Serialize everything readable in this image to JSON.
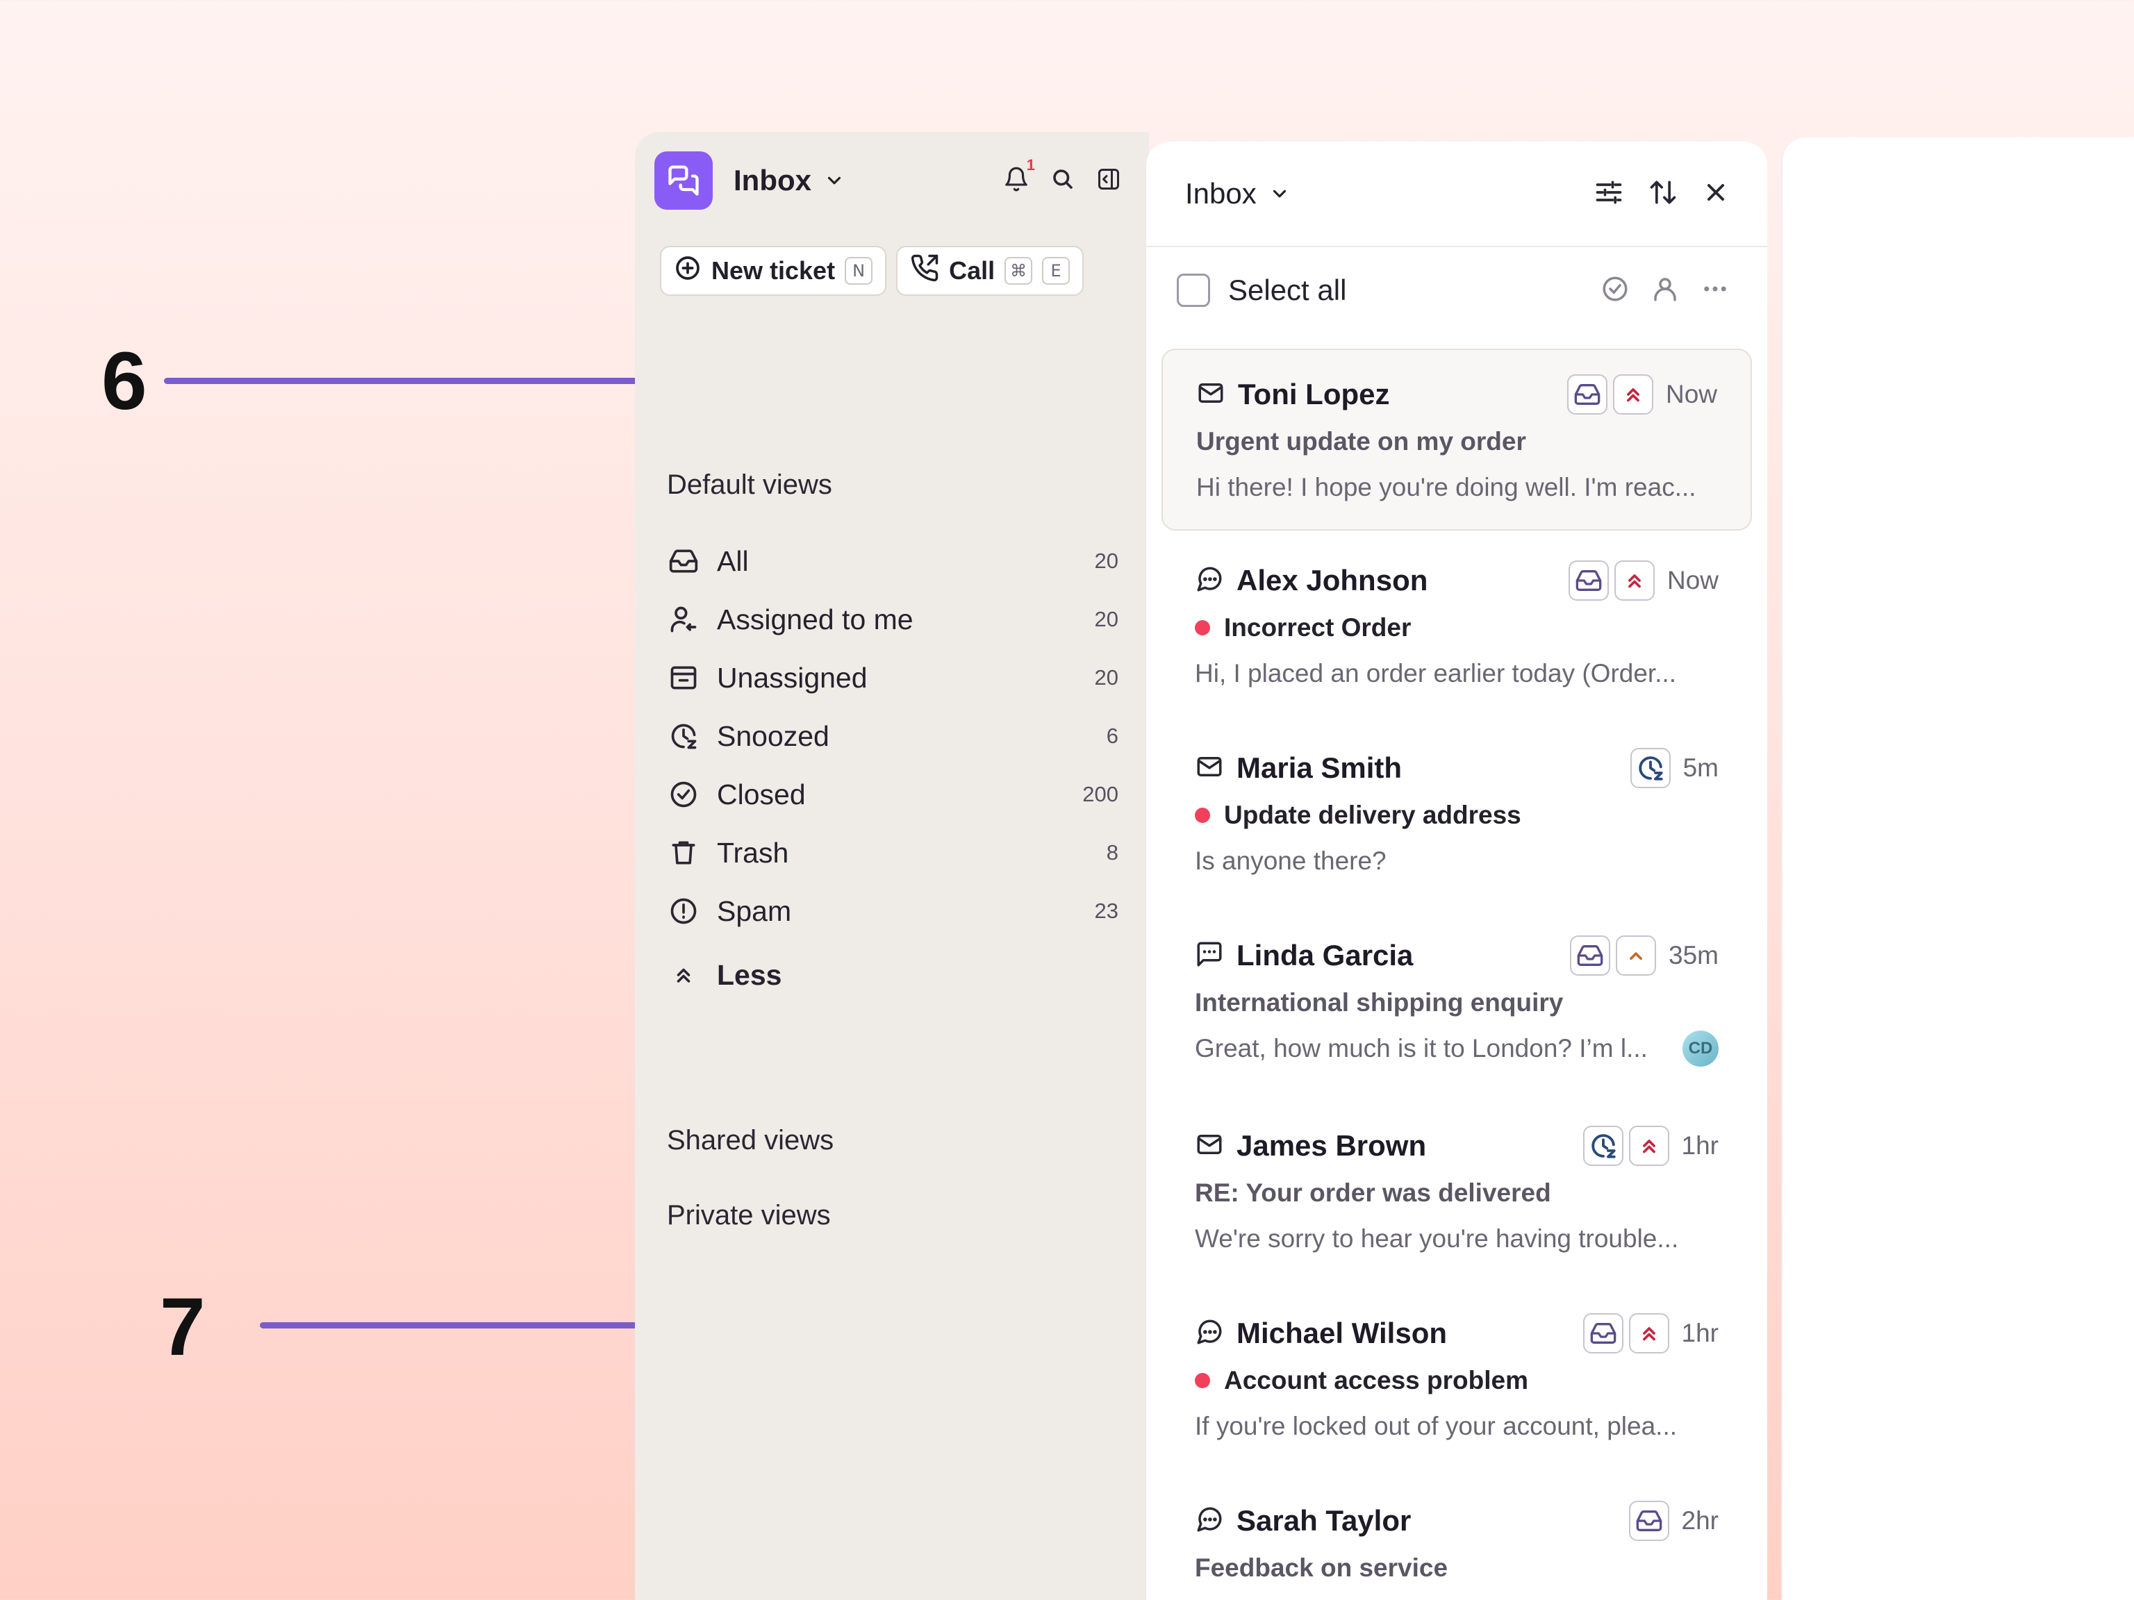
{
  "annotations": [
    {
      "number": "6"
    },
    {
      "number": "7"
    }
  ],
  "sidebar": {
    "title": "Inbox",
    "notification_count": "1",
    "actions": [
      {
        "label": "New ticket",
        "shortcut": [
          "N"
        ]
      },
      {
        "label": "Call",
        "shortcut": [
          "⌘",
          "E"
        ]
      }
    ],
    "default_views_title": "Default views",
    "views": [
      {
        "label": "All",
        "count": "20",
        "icon": "inbox-icon"
      },
      {
        "label": "Assigned to me",
        "count": "20",
        "icon": "user-assigned-icon"
      },
      {
        "label": "Unassigned",
        "count": "20",
        "icon": "folder-icon"
      },
      {
        "label": "Snoozed",
        "count": "6",
        "icon": "snooze-clock-icon"
      },
      {
        "label": "Closed",
        "count": "200",
        "icon": "check-circle-icon"
      },
      {
        "label": "Trash",
        "count": "8",
        "icon": "trash-icon"
      },
      {
        "label": "Spam",
        "count": "23",
        "icon": "alert-circle-icon"
      }
    ],
    "less_label": "Less",
    "shared_views_title": "Shared views",
    "private_views_title": "Private views"
  },
  "list": {
    "title": "Inbox",
    "select_all_label": "Select all",
    "tickets": [
      {
        "channel": "email",
        "name": "Toni Lopez",
        "tags": [
          "inbox",
          "urgent"
        ],
        "time": "Now",
        "subject": "Urgent update on my order",
        "unread": false,
        "preview": "Hi there! I hope you're doing well. I'm reac...",
        "avatar": ""
      },
      {
        "channel": "chat",
        "name": "Alex Johnson",
        "tags": [
          "inbox",
          "urgent"
        ],
        "time": "Now",
        "subject": "Incorrect Order",
        "unread": true,
        "preview": "Hi, I placed an order earlier today (Order...",
        "avatar": ""
      },
      {
        "channel": "email",
        "name": "Maria Smith",
        "tags": [
          "snoozed"
        ],
        "time": "5m",
        "subject": "Update delivery address",
        "unread": true,
        "preview": "Is anyone there?",
        "avatar": ""
      },
      {
        "channel": "sms",
        "name": "Linda Garcia",
        "tags": [
          "inbox",
          "medium"
        ],
        "time": "35m",
        "subject": "International shipping enquiry",
        "unread": false,
        "preview": "Great, how much is it to London? I’m l...",
        "avatar": "CD"
      },
      {
        "channel": "email",
        "name": "James Brown",
        "tags": [
          "snoozed",
          "urgent"
        ],
        "time": "1hr",
        "subject": "RE: Your order was delivered",
        "unread": false,
        "preview": "We're sorry to hear you're having trouble...",
        "avatar": ""
      },
      {
        "channel": "chat",
        "name": "Michael Wilson",
        "tags": [
          "inbox",
          "urgent"
        ],
        "time": "1hr",
        "subject": "Account access problem",
        "unread": true,
        "preview": "If you're locked out of your account, plea...",
        "avatar": ""
      },
      {
        "channel": "chat",
        "name": "Sarah Taylor",
        "tags": [
          "inbox"
        ],
        "time": "2hr",
        "subject": "Feedback on service",
        "unread": false,
        "preview": "",
        "avatar": ""
      }
    ]
  },
  "colors": {
    "accent": "#7a5ccc",
    "logo": "#8a5cf6",
    "unread_dot": "#f0405c",
    "urgent": "#c8253e",
    "medium": "#c86a2a",
    "snooze": "#2a4a7a"
  }
}
